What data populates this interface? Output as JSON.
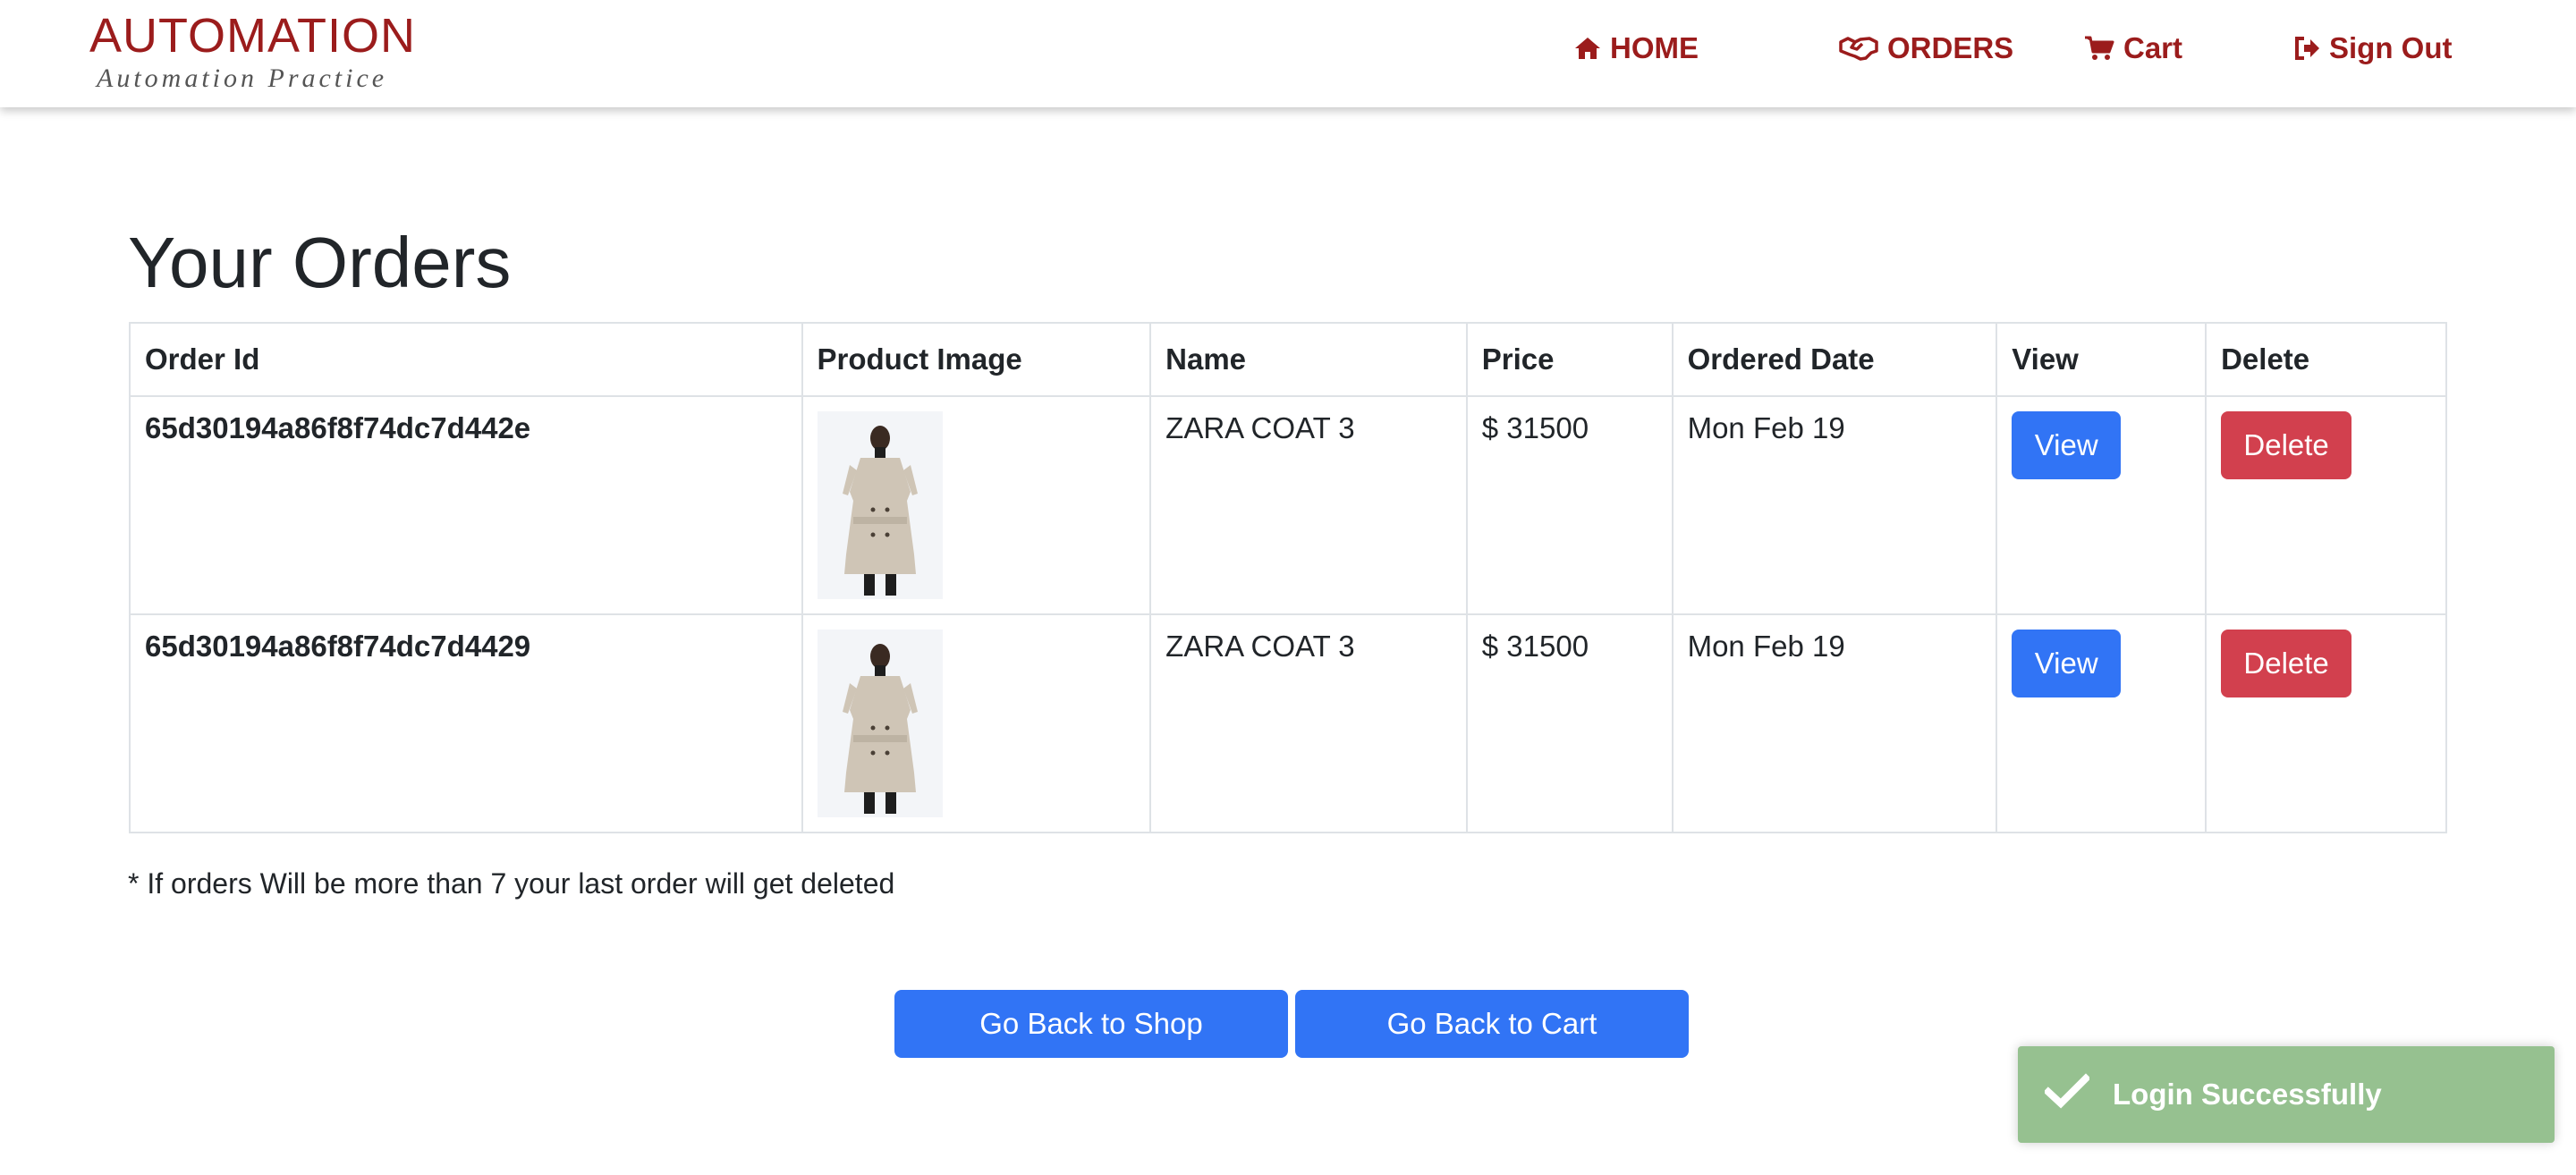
{
  "brand": {
    "title": "AUTOMATION",
    "subtitle": "Automation Practice"
  },
  "nav": {
    "home": "HOME",
    "orders": "ORDERS",
    "cart": "Cart",
    "sign_out": "Sign Out"
  },
  "page": {
    "title": "Your Orders",
    "note": "* If orders Will be more than 7 your last order will get deleted"
  },
  "table": {
    "headers": [
      "Order Id",
      "Product Image",
      "Name",
      "Price",
      "Ordered Date",
      "View",
      "Delete"
    ],
    "rows": [
      {
        "order_id": "65d30194a86f8f74dc7d442e",
        "name": "ZARA COAT 3",
        "price": "$ 31500",
        "ordered_date": "Mon Feb 19",
        "view_label": "View",
        "delete_label": "Delete"
      },
      {
        "order_id": "65d30194a86f8f74dc7d4429",
        "name": "ZARA COAT 3",
        "price": "$ 31500",
        "ordered_date": "Mon Feb 19",
        "view_label": "View",
        "delete_label": "Delete"
      }
    ]
  },
  "actions": {
    "back_to_shop": "Go Back to Shop",
    "back_to_cart": "Go Back to Cart"
  },
  "toast": {
    "message": "Login Successfully",
    "icon": "check-icon"
  },
  "colors": {
    "brand": "#9b1c1c",
    "primary": "#3174f5",
    "danger": "#d2404e",
    "toast": "#96c190"
  }
}
